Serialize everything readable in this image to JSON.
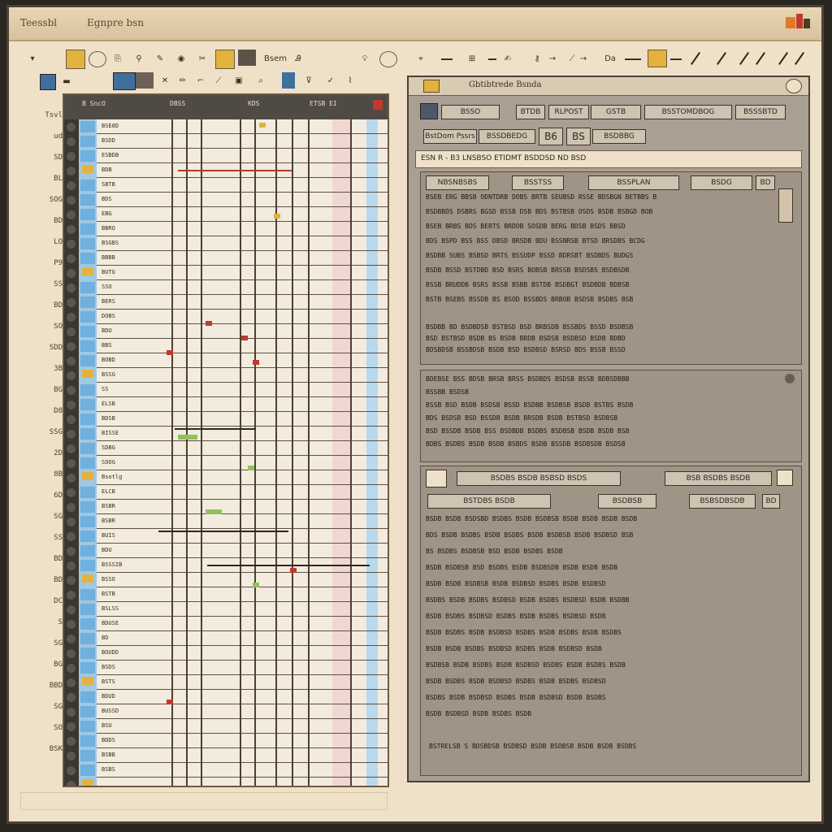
{
  "window": {
    "title_left": "Teessbl",
    "title_app": "Egnpre bsn"
  },
  "toolbar": {
    "label_a": "Bsem",
    "label_b": "Da"
  },
  "gutter_labels": [
    "Tsvl",
    "ud",
    "SD",
    "BL",
    "SOG",
    "BD",
    "LO",
    "P9",
    "SS",
    "BD",
    "SO",
    "SDD",
    "3B",
    "BG",
    "D8",
    "SSG",
    "2D",
    "8B",
    "6D",
    "SG",
    "SS",
    "BD",
    "BD",
    "DC",
    "S",
    "SG",
    "BG",
    "BBD",
    "SG",
    "SO",
    "BSK"
  ],
  "sheet": {
    "headers": [
      "B SncO",
      "DBSS",
      "KDS",
      "ETSB EI"
    ],
    "row_codes": [
      "BSE8D",
      "BSDD",
      "ESBDB",
      "BDB",
      "SBTB",
      "BDS",
      "EBG",
      "BBRO",
      "BSGBS",
      "BBBB",
      "BUTG",
      "SSO",
      "BERS",
      "DOBS",
      "BDU",
      "BBS",
      "BOBD",
      "BSSG",
      "SS",
      "ELSB",
      "BDSB",
      "BISSE",
      "SDBG",
      "SOOG",
      "Bsotlg",
      "ELCB",
      "BSBR",
      "BSBR",
      "BUIS",
      "BDU",
      "BSSSIB",
      "BSSO",
      "BSTB",
      "BSLSS",
      "BDUSE",
      "BD",
      "BOUDD",
      "BSDS",
      "BSTS",
      "BDUD",
      "BUSSD",
      "BSU",
      "BDDS",
      "BSBB",
      "BSBS"
    ]
  },
  "panel": {
    "title": "Gbtibtrede Bsnda",
    "toolbar_buttons": [
      "BSSO",
      "BTDB",
      "RLPOST",
      "GSTB",
      "BSSTOMDBOG",
      "BSSSBTD"
    ],
    "toolbar_buttons_row2": [
      "BstDom Pssrs",
      "BSSDBEDG",
      "B6",
      "BS",
      "BSDBBG"
    ],
    "header_line": "ESN R - B3 LNSBSO ETIDMT BSDDSD ND BSD",
    "section1": {
      "controls": [
        "NBSNBSBS",
        "BSSTSS",
        "BSSPLAN",
        "BSDG",
        "BD"
      ],
      "lines": [
        "BSEB ERG BBSB ODNTDRB DOBS BRTB SEUBSD RSSE BDSBGN BETBBS B",
        "BSDBBDS DSBRS BGSD BSSB DSB BDS BSTBSB OSDS BSDB BSBGD BOB",
        "BSEB BRBS BDS BERTS BRDOB SOSDB BERG BDSB BSDS BBSD",
        "BDS BSPD BSS BSS DBSD BRSDB BDU BSSNRSB BTSD BRSDBS BCDG",
        "BSDBB SUBS BSBSD BRTS BSSUDP BSSD BDRSBT BSDBDS BUDGS",
        "BSDB BSSD BSTDBD BSD BSRS BOBSB BRSSB BSDSBS BSDBSDB",
        "BSSB BRUDDB BSRS BSSB BSBB BSTDB BSDBGT BSDBDB BDBSB",
        "BSTB BSEBS BSSDB BS BSOD BSSBDS BRBOB BSDSB BSDBS BSB"
      ],
      "lines_b": [
        "BSDBB BD BSDBDSB BSTBSD BSD BRBSDB BSSBDS BSSD BSDBSB",
        "BSD BSTBSD BSDB BS BSDB BRDB BSDSB BSDBSD BSDB BDBD",
        "BDSBDSB BSSBDSB BSDB BSD BSDBSD BSRSD BDS BSSB BSSD"
      ]
    },
    "section2": {
      "title": "BDEBSE BSS BDSB BRSB BRSS BSDBDS BSDSB BSSB BDBSDBBB",
      "lines": [
        "BSSBB BSDSB",
        "BSSB BSD BSDB BSDSB BSSD BSDBB BSDBSB BSDB BSTBS BSDB",
        "BDS BSDSB BSD BSSDB BSDB BRSDB BSDB BSTBSD BSDBSB",
        "BSD BSSDB BSDB BSS BSDBDB BSDBS BSDBSB BSDB BSDB BSB",
        "BDBS BSDBS BSDB BSDB BSBDS BSDB BSSDB BSDBSDB BSDSB"
      ]
    },
    "section3": {
      "controls": [
        "BSDBS BSDB BSBSD BSDS",
        "BSB BSDBS BSDB"
      ],
      "controls2": [
        "BSTDBS BSDB",
        "BSDBSB",
        "BSBSDBSDB",
        "BD"
      ],
      "lines": [
        "BSDB BSDB BSDSBD BSDBS BSDB BSDBSB BSDB BSDB BSDB BSDB",
        "BDS BSDB BSDBS BSDB BSDBS BSDB BSDBSB BSDB BSDBSD BSB",
        "BS BSDBS BSDBSB BSD BSDB BSDBS BSDB",
        "BSDB BSDBSB BSD BSDBS BSDB BSDBSDB BSDB BSDB BSDB",
        "BSDB BSDB BSDBSB BSDB BSDBSD BSDBS BSDB BSDBSD",
        "BSDBS BSDB BSDBS BSDBSD BSDB BSDBS BSDBSD BSDB BSDBB",
        "BSDB BSDBS BSDBSD BSDBS BSDB BSDBS BSDBSD BSDB",
        "BSDB BSDBS BSDB BSDBSD BSDBS BSDB BSDBS BSDB BSDBS",
        "BSDB BSDB BSDBS BSDBSD BSDBS BSDB BSDBSD BSDB",
        "BSDBSB BSDB BSDBS BSDB BSDBSD BSDBS BSDB BSDBS BSDB",
        "BSDB BSDBS BSDB BSDBSD BSDBS BSDB BSDBS BSDBSD",
        "BSDBS BSDB BSDBSD BSDBS BSDB BSDBSD BSDB BSDBS",
        "BSDB BSDBSD BSDB BSDBS BSDB"
      ],
      "footer": "BSTRELSB S BDSBDSB BSDBSD BSDB BSDBSB BSDB BSDB BSDBS"
    }
  },
  "colors": {
    "window_bg": "#efe1c8",
    "panel_bg": "#a99f92",
    "accent_blue": "#9fc8e3",
    "accent_yellow": "#e3b23c",
    "accent_red": "#c0392b"
  }
}
